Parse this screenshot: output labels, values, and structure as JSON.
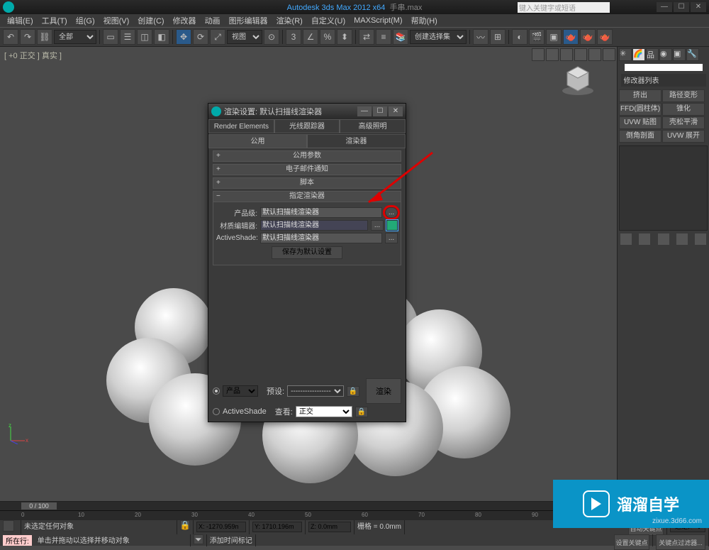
{
  "title": {
    "app": "Autodesk 3ds Max  2012 x64",
    "file": "手串.max",
    "search_placeholder": "键入关键字或短语"
  },
  "menu": [
    "编辑(E)",
    "工具(T)",
    "组(G)",
    "视图(V)",
    "创建(C)",
    "修改器",
    "动画",
    "图形编辑器",
    "渲染(R)",
    "自定义(U)",
    "MAXScript(M)",
    "帮助(H)"
  ],
  "viewport": {
    "label": "[ +0 正交 ] 真实 ]"
  },
  "cmdpanel": {
    "modifier_list": "修改器列表",
    "buttons": [
      "挤出",
      "路径变形",
      "FFD(圆柱体)",
      "锥化",
      "UVW 贴图",
      "壳松平滑",
      "倒角剖面",
      "UVW 展开"
    ]
  },
  "dialog": {
    "title": "渲染设置: 默认扫描线渲染器",
    "tabs_top": [
      "Render Elements",
      "光线跟踪器",
      "高级照明"
    ],
    "tabs_bot": [
      "公用",
      "渲染器"
    ],
    "rollouts": [
      "公用参数",
      "电子邮件通知",
      "脚本",
      "指定渲染器"
    ],
    "rows": {
      "prod_label": "产品级:",
      "prod_value": "默认扫描线渲染器",
      "mat_label": "材质编辑器:",
      "mat_value": "默认扫描线渲染器",
      "active_label": "ActiveShade:",
      "active_value": "默认扫描线渲染器"
    },
    "save_btn": "保存为默认设置",
    "bottom": {
      "product": "产品",
      "activeshade": "ActiveShade",
      "preset_label": "预设:",
      "preset_value": "-----------------",
      "view_label": "查看:",
      "view_value": "正交",
      "render_btn": "渲染"
    }
  },
  "status": {
    "none_selected": "未选定任何对象",
    "x": "X: -1270.959n",
    "y": "Y: 1710.196m",
    "z": "Z: 0.0mm",
    "grid": "栅格 = 0.0mm",
    "autokey": "自动关键点",
    "selset": "选定对象",
    "setkey": "设置关键点",
    "keyfilter": "关键点过滤器...",
    "prompt": "单击并拖动以选择并移动对象",
    "addtime": "添加时间标记",
    "timeslider": "0 / 100",
    "line_label": "所在行:"
  },
  "watermark": {
    "text": "溜溜自学",
    "url": "zixue.3d66.com"
  }
}
